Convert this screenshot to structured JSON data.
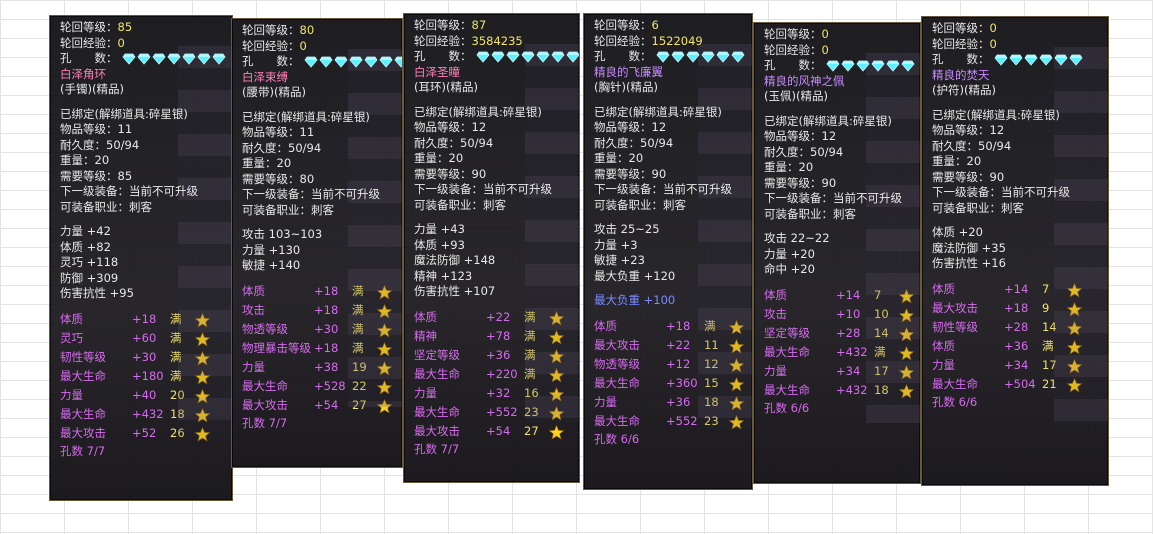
{
  "labels": {
    "reincarnation_level": "轮回等级：",
    "reincarnation_exp": "轮回经验：",
    "holes": "孔　　数："
  },
  "colors": {
    "gem": "#5ff0ff",
    "star": "#ffd21e",
    "pink_name": "#ff7fb8",
    "purple_name": "#c78bff",
    "enhance": "#d76bf0",
    "value": "#f2e36a"
  },
  "icons": {
    "gem": "diamond-gem-icon",
    "star": "star-icon"
  },
  "cards": [
    {
      "level": "85",
      "exp": "0",
      "gems": 7,
      "name": "白泽角环",
      "name_color": "pink",
      "slot": "(手镯)(精品)",
      "binding": "已绑定(解绑道具:碎星银)",
      "item_level": "物品等级：11",
      "durability": "耐久度：50/94",
      "weight": "重量：20",
      "req_level": "需要等级：85",
      "next": "下一级装备：当前不可升级",
      "job": "可装备职业：刺客",
      "attrs": [
        "力量 +42",
        "体质 +82",
        "灵巧 +118",
        "防御 +309",
        "伤害抗性 +95"
      ],
      "enh": [
        {
          "n": "体质",
          "v": "+18",
          "m": "满"
        },
        {
          "n": "灵巧",
          "v": "+60",
          "m": "满"
        },
        {
          "n": "韧性等级",
          "v": "+30",
          "m": "满"
        },
        {
          "n": "最大生命",
          "v": "+180",
          "m": "满"
        },
        {
          "n": "力量",
          "v": "+40",
          "m": "20"
        },
        {
          "n": "最大生命",
          "v": "+432",
          "m": "18"
        },
        {
          "n": "最大攻击",
          "v": "+52",
          "m": "26"
        }
      ],
      "footer": "孔数 7/7"
    },
    {
      "level": "80",
      "exp": "0",
      "gems": 7,
      "name": "白泽束缚",
      "name_color": "pink",
      "slot": "(腰带)(精品)",
      "binding": "已绑定(解绑道具:碎星银)",
      "item_level": "物品等级：11",
      "durability": "耐久度：50/94",
      "weight": "重量：20",
      "req_level": "需要等级：80",
      "next": "下一级装备：当前不可升级",
      "job": "可装备职业：刺客",
      "attrs": [
        "攻击 103~103",
        "力量 +130",
        "敏捷 +140"
      ],
      "enh": [
        {
          "n": "体质",
          "v": "+18",
          "m": "满"
        },
        {
          "n": "攻击",
          "v": "+18",
          "m": "满"
        },
        {
          "n": "物透等级",
          "v": "+30",
          "m": "满"
        },
        {
          "n": "物理暴击等级",
          "v": "+18",
          "m": "满"
        },
        {
          "n": "力量",
          "v": "+38",
          "m": "19"
        },
        {
          "n": "最大生命",
          "v": "+528",
          "m": "22"
        },
        {
          "n": "最大攻击",
          "v": "+54",
          "m": "27"
        }
      ],
      "footer": "孔数 7/7"
    },
    {
      "level": "87",
      "exp": "3584235",
      "gems": 7,
      "name": "白泽圣瞳",
      "name_color": "pink",
      "slot": "(耳环)(精品)",
      "binding": "已绑定(解绑道具:碎星银)",
      "item_level": "物品等级：12",
      "durability": "耐久度：50/94",
      "weight": "重量：20",
      "req_level": "需要等级：90",
      "next": "下一级装备：当前不可升级",
      "job": "可装备职业：刺客",
      "attrs": [
        "力量 +43",
        "体质 +93",
        "魔法防御 +148",
        "精神 +123",
        "伤害抗性 +107"
      ],
      "enh": [
        {
          "n": "体质",
          "v": "+22",
          "m": "满"
        },
        {
          "n": "精神",
          "v": "+78",
          "m": "满"
        },
        {
          "n": "坚定等级",
          "v": "+36",
          "m": "满"
        },
        {
          "n": "最大生命",
          "v": "+220",
          "m": "满"
        },
        {
          "n": "力量",
          "v": "+32",
          "m": "16"
        },
        {
          "n": "最大生命",
          "v": "+552",
          "m": "23"
        },
        {
          "n": "最大攻击",
          "v": "+54",
          "m": "27"
        }
      ],
      "footer": "孔数 7/7"
    },
    {
      "level": "6",
      "exp": "1522049",
      "gems": 6,
      "name": "精良的飞廉翼",
      "name_color": "purple",
      "slot": "(胸针)(精品)",
      "binding": "已绑定(解绑道具:碎星银)",
      "item_level": "物品等级：12",
      "durability": "耐久度：50/94",
      "weight": "重量：20",
      "req_level": "需要等级：90",
      "next": "下一级装备：当前不可升级",
      "job": "可装备职业：刺客",
      "attrs": [
        "攻击 25~25",
        "力量 +3",
        "敏捷 +23",
        "最大负重 +120"
      ],
      "extra": "最大负重 +100",
      "enh": [
        {
          "n": "体质",
          "v": "+18",
          "m": "满"
        },
        {
          "n": "最大攻击",
          "v": "+22",
          "m": "11"
        },
        {
          "n": "物透等级",
          "v": "+12",
          "m": "12"
        },
        {
          "n": "最大生命",
          "v": "+360",
          "m": "15"
        },
        {
          "n": "力量",
          "v": "+36",
          "m": "18"
        },
        {
          "n": "最大生命",
          "v": "+552",
          "m": "23"
        }
      ],
      "footer": "孔数 6/6"
    },
    {
      "level": "0",
      "exp": "0",
      "gems": 6,
      "name": "精良的风神之佩",
      "name_color": "purple",
      "slot": "(玉佩)(精品)",
      "binding": "已绑定(解绑道具:碎星银)",
      "item_level": "物品等级：12",
      "durability": "耐久度：50/94",
      "weight": "重量：20",
      "req_level": "需要等级：90",
      "next": "下一级装备：当前不可升级",
      "job": "可装备职业：刺客",
      "attrs": [
        "攻击 22~22",
        "力量 +20",
        "命中 +20"
      ],
      "enh": [
        {
          "n": "体质",
          "v": "+14",
          "m": "7"
        },
        {
          "n": "攻击",
          "v": "+10",
          "m": "10"
        },
        {
          "n": "坚定等级",
          "v": "+28",
          "m": "14"
        },
        {
          "n": "最大生命",
          "v": "+432",
          "m": "满"
        },
        {
          "n": "力量",
          "v": "+34",
          "m": "17"
        },
        {
          "n": "最大生命",
          "v": "+432",
          "m": "18"
        }
      ],
      "footer": "孔数 6/6"
    },
    {
      "level": "0",
      "exp": "0",
      "gems": 6,
      "name": "精良的焚天",
      "name_color": "purple",
      "slot": "(护符)(精品)",
      "binding": "已绑定(解绑道具:碎星银)",
      "item_level": "物品等级：12",
      "durability": "耐久度：50/94",
      "weight": "重量：20",
      "req_level": "需要等级：90",
      "next": "下一级装备：当前不可升级",
      "job": "可装备职业：刺客",
      "attrs": [
        "体质 +20",
        "魔法防御 +35",
        "伤害抗性 +16"
      ],
      "enh": [
        {
          "n": "体质",
          "v": "+14",
          "m": "7"
        },
        {
          "n": "最大攻击",
          "v": "+18",
          "m": "9"
        },
        {
          "n": "韧性等级",
          "v": "+28",
          "m": "14"
        },
        {
          "n": "体质",
          "v": "+36",
          "m": "满"
        },
        {
          "n": "力量",
          "v": "+34",
          "m": "17"
        },
        {
          "n": "最大生命",
          "v": "+504",
          "m": "21"
        }
      ],
      "footer": "孔数 6/6"
    }
  ]
}
